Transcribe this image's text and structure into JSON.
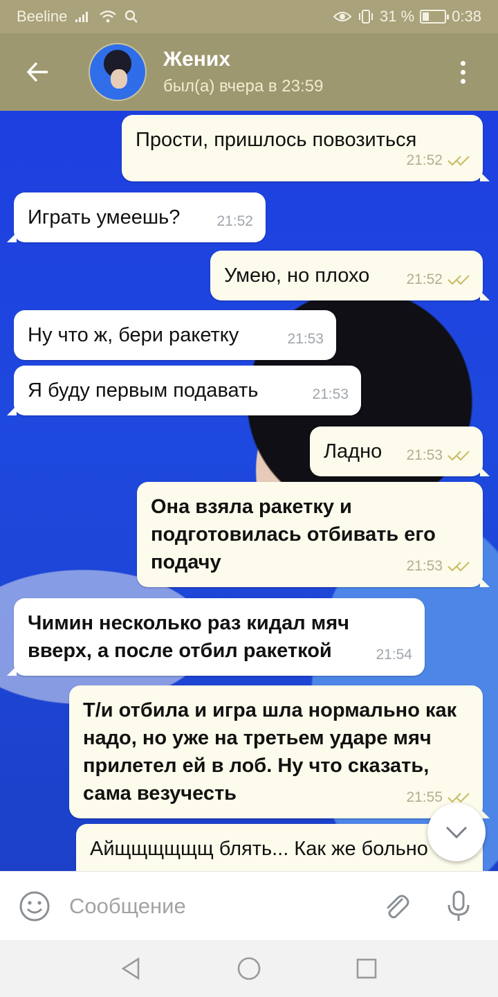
{
  "status_bar": {
    "carrier": "Beeline",
    "battery_percent": "31 %",
    "battery_level": 0.31,
    "time": "0:38"
  },
  "header": {
    "title": "Жених",
    "subtitle": "был(а) вчера в 23:59"
  },
  "messages": [
    {
      "direction": "out",
      "text": "Прости, пришлось повозиться",
      "time": "21:52",
      "read": true
    },
    {
      "direction": "in",
      "text": "Играть умеешь?",
      "time": "21:52"
    },
    {
      "direction": "out",
      "text": "Умею, но плохо",
      "time": "21:52",
      "read": true
    },
    {
      "direction": "in",
      "text": "Ну что ж, бери ракетку",
      "time": "21:53"
    },
    {
      "direction": "in",
      "text": "Я буду первым подавать",
      "time": "21:53"
    },
    {
      "direction": "out",
      "text": "Ладно",
      "time": "21:53",
      "read": true
    },
    {
      "direction": "out",
      "text": "Она взяла ракетку и подготовилась отбивать его подачу",
      "time": "21:53",
      "read": true
    },
    {
      "direction": "in",
      "text": "Чимин несколько раз кидал мяч вверх, а после отбил ракеткой",
      "time": "21:54"
    },
    {
      "direction": "out",
      "text": "Т/и отбила и игра шла нормально как надо, но уже на третьем ударе мяч прилетел ей в лоб. Ну что сказать, сама везучесть",
      "time": "21:55",
      "read": true
    },
    {
      "direction": "out",
      "text": "Айщщщщщщ блять... Как же больно",
      "time": "",
      "read": false
    }
  ],
  "input": {
    "placeholder": "Сообщение"
  },
  "icons": {
    "back": "arrow-left-icon",
    "more": "more-vertical-icon",
    "emoji": "smile-icon",
    "attach": "paperclip-icon",
    "mic": "microphone-icon",
    "scroll": "chevron-down-icon",
    "read": "double-check-icon"
  },
  "colors": {
    "header": "#9e9870",
    "status_bar": "#a9a27a",
    "outgoing_bubble": "#fdfbeb",
    "incoming_bubble": "#ffffff",
    "check": "#c9bd6a"
  }
}
